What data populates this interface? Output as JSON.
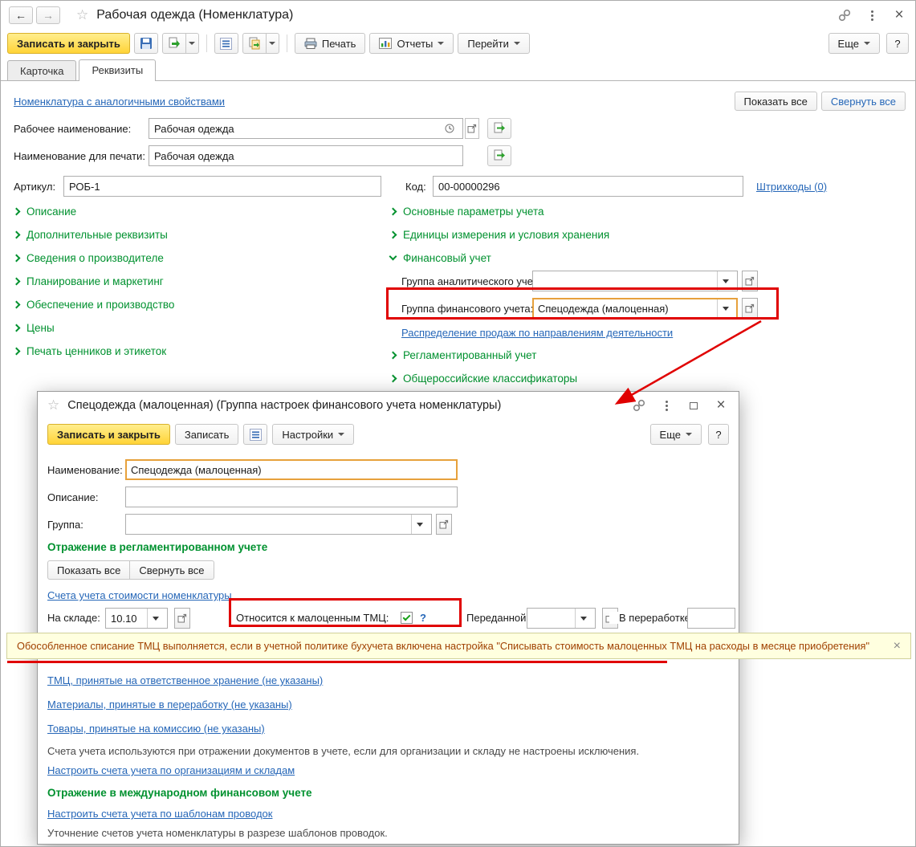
{
  "icons": {
    "back": "←",
    "forward": "→",
    "star": "☆",
    "close": "×"
  },
  "main_window": {
    "title": "Рабочая одежда (Номенклатура)",
    "toolbar": {
      "save_close": "Записать и закрыть",
      "print": "Печать",
      "reports": "Отчеты",
      "goto": "Перейти",
      "more": "Еще",
      "help": "?"
    },
    "tabs": [
      {
        "label": "Карточка"
      },
      {
        "label": "Реквизиты"
      }
    ],
    "similar_link": "Номенклатура с аналогичными свойствами",
    "show_all": "Показать все",
    "collapse_all": "Свернуть все",
    "fields": {
      "working_name_label": "Рабочее наименование:",
      "working_name_value": "Рабочая одежда",
      "print_name_label": "Наименование для печати:",
      "print_name_value": "Рабочая одежда",
      "article_label": "Артикул:",
      "article_value": "РОБ-1",
      "code_label": "Код:",
      "code_value": "00-00000296",
      "barcodes_link": "Штрихкоды (0)"
    },
    "left_sections": [
      {
        "label": "Описание"
      },
      {
        "label": "Дополнительные реквизиты"
      },
      {
        "label": "Сведения о производителе"
      },
      {
        "label": "Планирование и маркетинг"
      },
      {
        "label": "Обеспечение и производство"
      },
      {
        "label": "Цены"
      },
      {
        "label": "Печать ценников и этикеток"
      }
    ],
    "right_sections": {
      "main_params": "Основные параметры учета",
      "units": "Единицы измерения и условия хранения",
      "financial": "Финансовый учет",
      "analytic_group_label": "Группа аналитического учета:",
      "analytic_group_value": "",
      "fin_group_label": "Группа финансового учета:",
      "fin_group_value": "Спецодежда (малоценная)",
      "sales_link": "Распределение продаж по направлениям деятельности",
      "regulated": "Регламентированный учет",
      "classifiers": "Общероссийские классификаторы"
    }
  },
  "modal": {
    "title": "Спецодежда (малоценная) (Группа настроек финансового учета номенклатуры)",
    "toolbar": {
      "save_close": "Записать и закрыть",
      "save": "Записать",
      "settings": "Настройки",
      "more": "Еще",
      "help": "?"
    },
    "fields": {
      "name_label": "Наименование:",
      "name_value": "Спецодежда (малоценная)",
      "description_label": "Описание:",
      "description_value": "",
      "group_label": "Группа:",
      "group_value": ""
    },
    "regulated_header": "Отражение в регламентированном учете",
    "show_all": "Показать все",
    "collapse_all": "Свернуть все",
    "accounts_link": "Счета учета стоимости номенклатуры",
    "stock_row": {
      "warehouse_label": "На складе:",
      "warehouse_value": "10.10",
      "lowvalue_label": "Относится к малоценным ТМЦ:",
      "lowvalue_checked": true,
      "help": "?",
      "transferred_label": "Переданной:",
      "transferred_value": "",
      "processing_label": "В переработке:",
      "processing_value": ""
    },
    "links": [
      {
        "label": "ТМЦ, принятые на ответственное хранение (не указаны)"
      },
      {
        "label": "Материалы, принятые в переработку (не указаны)"
      },
      {
        "label": "Товары, принятые на комиссию (не указаны)"
      }
    ],
    "accounts_note": "Счета учета используются при отражении документов в учете, если для организации и складу не настроены исключения.",
    "setup_accounts_link": "Настроить счета учета по организациям и складам",
    "international_header": "Отражение в международном финансовом учете",
    "templates_link": "Настроить счета учета по шаблонам проводок",
    "templates_note": "Уточнение счетов учета номенклатуры в разрезе шаблонов проводок."
  },
  "notification": {
    "text": "Обособленное списание ТМЦ выполняется, если в учетной политике бухучета включена настройка \"Списывать стоимость малоценных ТМЦ на расходы в месяце приобретения\""
  }
}
